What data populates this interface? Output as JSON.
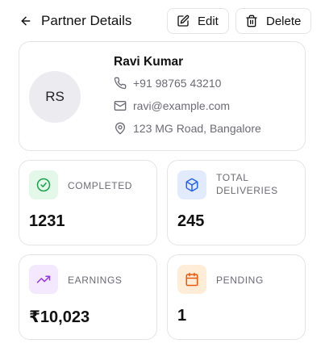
{
  "header": {
    "title": "Partner Details",
    "edit_label": "Edit",
    "delete_label": "Delete"
  },
  "partner": {
    "initials": "RS",
    "name": "Ravi Kumar",
    "phone": "+91 98765 43210",
    "email": "ravi@example.com",
    "address": "123 MG Road, Bangalore"
  },
  "stats": [
    {
      "label": "COMPLETED",
      "value": "1231",
      "icon": "check-circle-icon",
      "icon_color": "#16a34a",
      "bg": "#e3f8e9"
    },
    {
      "label_line1": "TOTAL",
      "label_line2": "DELIVERIES",
      "value": "245",
      "icon": "package-icon",
      "icon_color": "#2563eb",
      "bg": "#e2ebfd"
    },
    {
      "label": "EARNINGS",
      "value": "₹10,023",
      "icon": "trending-up-icon",
      "icon_color": "#9333ea",
      "bg": "#f3e8fe"
    },
    {
      "label": "PENDING",
      "value": "1",
      "icon": "calendar-icon",
      "icon_color": "#ea580c",
      "bg": "#ffedd8"
    }
  ]
}
